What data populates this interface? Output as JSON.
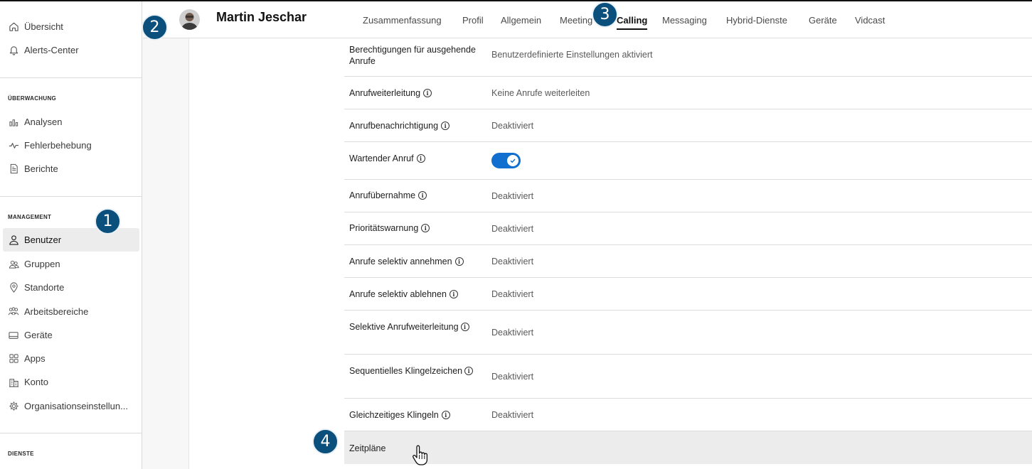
{
  "sidebar": {
    "top_items": [
      {
        "label": "Übersicht",
        "icon": "home-icon"
      },
      {
        "label": "Alerts-Center",
        "icon": "bell-icon"
      }
    ],
    "sections": [
      {
        "title": "ÜBERWACHUNG",
        "items": [
          {
            "label": "Analysen",
            "icon": "bar-chart-icon"
          },
          {
            "label": "Fehlerbehebung",
            "icon": "pulse-icon"
          },
          {
            "label": "Berichte",
            "icon": "report-icon"
          }
        ]
      },
      {
        "title": "MANAGEMENT",
        "items": [
          {
            "label": "Benutzer",
            "icon": "user-icon",
            "active": true
          },
          {
            "label": "Gruppen",
            "icon": "group-icon"
          },
          {
            "label": "Standorte",
            "icon": "location-pin-icon"
          },
          {
            "label": "Arbeitsbereiche",
            "icon": "workspaces-icon"
          },
          {
            "label": "Geräte",
            "icon": "device-icon"
          },
          {
            "label": "Apps",
            "icon": "apps-grid-icon"
          },
          {
            "label": "Konto",
            "icon": "building-icon"
          },
          {
            "label": "Organisationseinstellun...",
            "icon": "gear-icon"
          }
        ]
      },
      {
        "title": "DIENSTE",
        "items": []
      }
    ]
  },
  "header": {
    "user_name": "Martin Jeschar",
    "tabs": [
      {
        "label": "Zusammenfassung"
      },
      {
        "label": "Profil"
      },
      {
        "label": "Allgemein"
      },
      {
        "label": "Meeting"
      },
      {
        "label": "Calling",
        "active": true
      },
      {
        "label": "Messaging"
      },
      {
        "label": "Hybrid-Dienste"
      },
      {
        "label": "Geräte"
      },
      {
        "label": "Vidcast"
      }
    ]
  },
  "settings": {
    "rows": [
      {
        "label": "Berechtigungen für ausgehende Anrufe",
        "value": "Benutzerdefinierte Einstellungen aktiviert",
        "info": false
      },
      {
        "label": "Anrufweiterleitung",
        "value": "Keine Anrufe weiterleiten",
        "info": true
      },
      {
        "label": "Anrufbenachrichtigung",
        "value": "Deaktiviert",
        "info": true
      },
      {
        "label": "Wartender Anruf",
        "toggle_on": true,
        "info": true
      },
      {
        "label": "Anrufübernahme",
        "value": "Deaktiviert",
        "info": true
      },
      {
        "label": "Prioritätswarnung",
        "value": "Deaktiviert",
        "info": true
      },
      {
        "label": "Anrufe selektiv annehmen",
        "value": "Deaktiviert",
        "info": true
      },
      {
        "label": "Anrufe selektiv ablehnen",
        "value": "Deaktiviert",
        "info": true
      },
      {
        "label": "Selektive Anrufweiterleitung",
        "value": "Deaktiviert",
        "info": true
      },
      {
        "label": "Sequentielles Klingelzeichen",
        "value": "Deaktiviert",
        "info": true
      },
      {
        "label": "Gleichzeitiges Klingeln",
        "value": "Deaktiviert",
        "info": true
      },
      {
        "label": "Zeitpläne",
        "value": "",
        "info": false
      }
    ]
  },
  "markers": [
    "1",
    "2",
    "3",
    "4"
  ],
  "info_glyph": "i",
  "colors": {
    "toggle_on": "#1170cf",
    "marker_bg": "#0b4f7c",
    "active_nav_bg": "#ececec"
  }
}
